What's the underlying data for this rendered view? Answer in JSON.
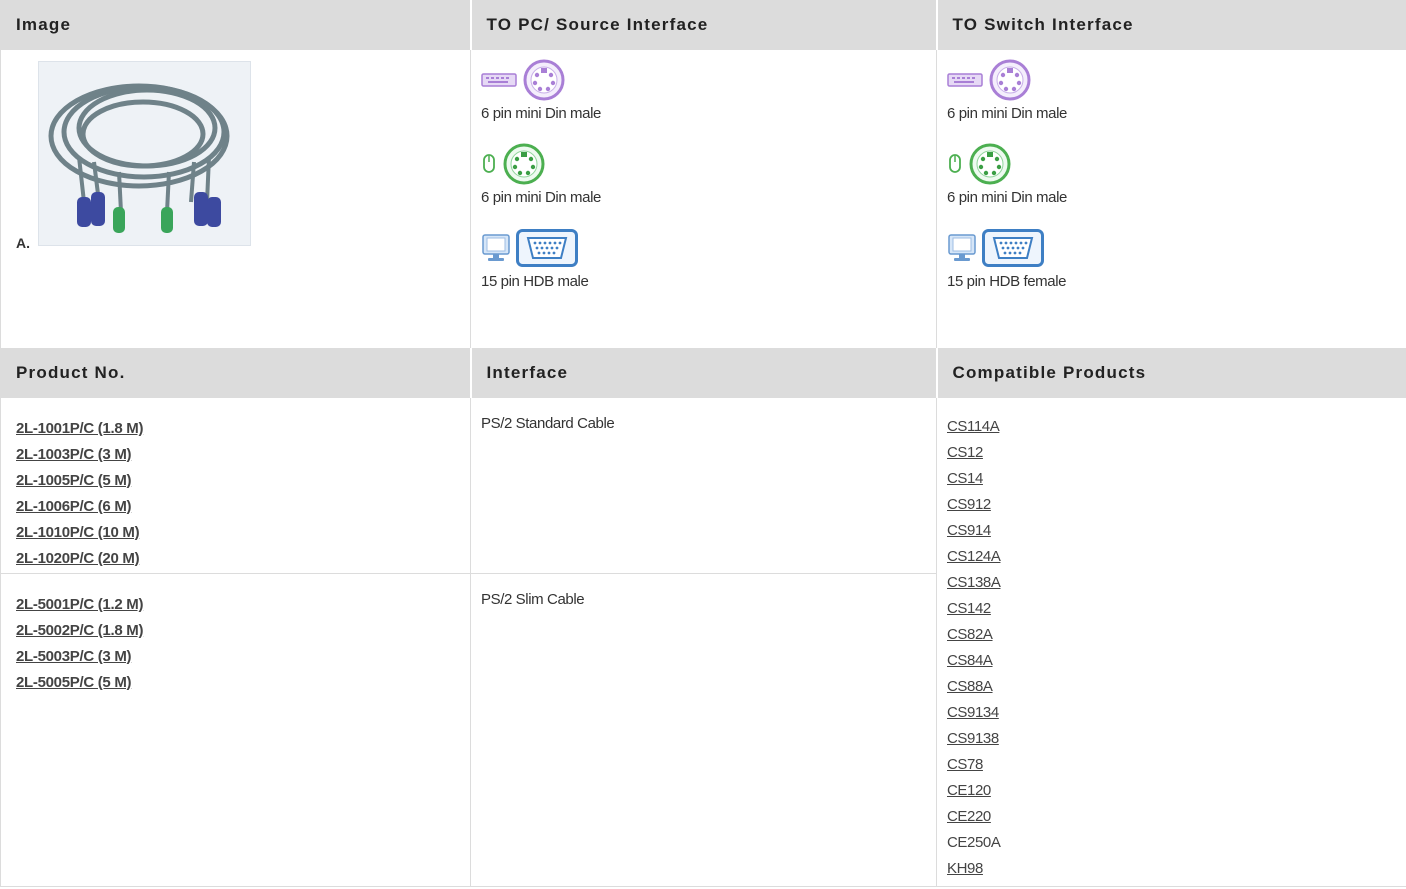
{
  "headers": {
    "image": "Image",
    "to_pc": "TO PC/ Source Interface",
    "to_switch": "TO Switch Interface",
    "product_no": "Product No.",
    "interface": "Interface",
    "compatible": "Compatible Products"
  },
  "image_label": "A.",
  "to_pc_ports": [
    {
      "icon": "keyboard-icon",
      "connector": "ps2-purple-connector-icon",
      "label": "6 pin mini Din male"
    },
    {
      "icon": "mouse-icon",
      "connector": "ps2-green-connector-icon",
      "label": "6 pin mini Din male"
    },
    {
      "icon": "monitor-icon",
      "connector": "vga-connector-icon",
      "label": "15 pin HDB male"
    }
  ],
  "to_switch_ports": [
    {
      "icon": "keyboard-icon",
      "connector": "ps2-purple-connector-icon",
      "label": "6 pin mini Din male"
    },
    {
      "icon": "mouse-icon",
      "connector": "ps2-green-connector-icon",
      "label": "6 pin mini Din male"
    },
    {
      "icon": "monitor-icon",
      "connector": "vga-connector-icon",
      "label": "15 pin HDB female"
    }
  ],
  "product_groups": [
    {
      "interface": "PS/2 Standard Cable",
      "products": [
        "2L-1001P/C (1.8 M)",
        "2L-1003P/C (3 M)",
        "2L-1005P/C (5 M)",
        "2L-1006P/C (6 M)",
        "2L-1010P/C (10 M)",
        "2L-1020P/C (20 M)"
      ]
    },
    {
      "interface": "PS/2 Slim Cable",
      "products": [
        "2L-5001P/C (1.2 M)",
        "2L-5002P/C (1.8 M)",
        "2L-5003P/C (3 M)",
        "2L-5005P/C (5 M)"
      ]
    }
  ],
  "compatible_products": [
    "CS114A",
    "CS12",
    "CS14",
    "CS912",
    "CS914",
    "CS124A",
    "CS138A",
    "CS142",
    "CS82A",
    "CS84A",
    "CS88A",
    "CS9134",
    "CS9138",
    "CS78",
    "CE120",
    "CE220",
    "CE250A",
    "KH98"
  ],
  "compatible_not_linked": [
    "CE250A"
  ],
  "colors": {
    "header_bg": "#dcdcdc",
    "border": "#dcdcdc",
    "ps2_keyboard": "#a97fd6",
    "ps2_mouse": "#4caf50",
    "vga": "#3e7fc4"
  }
}
